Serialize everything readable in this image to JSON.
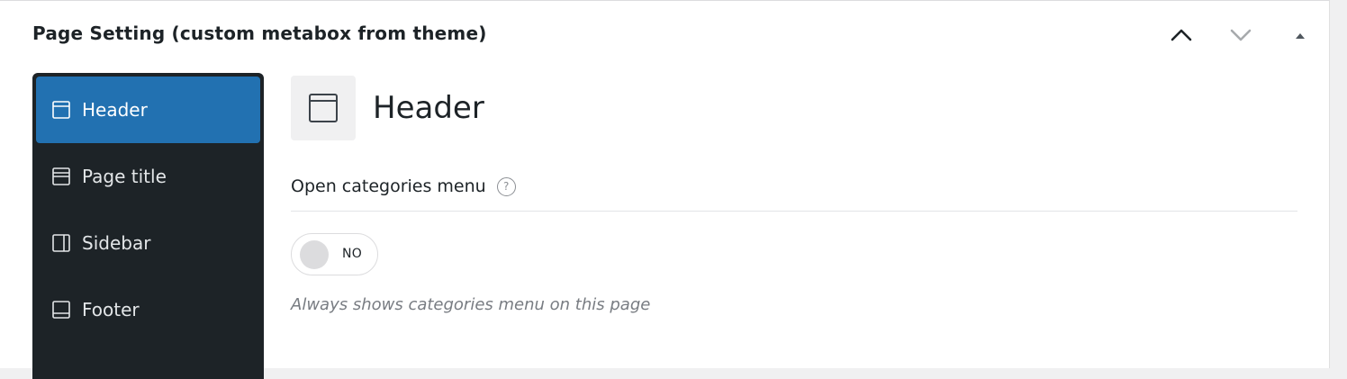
{
  "metabox": {
    "title": "Page Setting (custom metabox from theme)",
    "controls": {
      "move_up_icon": "chevron-up-icon",
      "move_down_icon": "chevron-down-icon",
      "toggle_icon": "triangle-up-icon"
    }
  },
  "sidebar_nav": {
    "items": [
      {
        "label": "Header",
        "icon": "header-layout-icon",
        "active": true
      },
      {
        "label": "Page title",
        "icon": "page-title-layout-icon",
        "active": false
      },
      {
        "label": "Sidebar",
        "icon": "sidebar-layout-icon",
        "active": false
      },
      {
        "label": "Footer",
        "icon": "footer-layout-icon",
        "active": false
      }
    ],
    "active_color": "#2271b1",
    "background_color": "#1d2327"
  },
  "section": {
    "title": "Header",
    "icon": "header-layout-icon",
    "fields": [
      {
        "label": "Open categories menu",
        "help": "?",
        "toggle_value": "NO",
        "toggle_on": false,
        "description": "Always shows categories menu on this page"
      }
    ]
  }
}
